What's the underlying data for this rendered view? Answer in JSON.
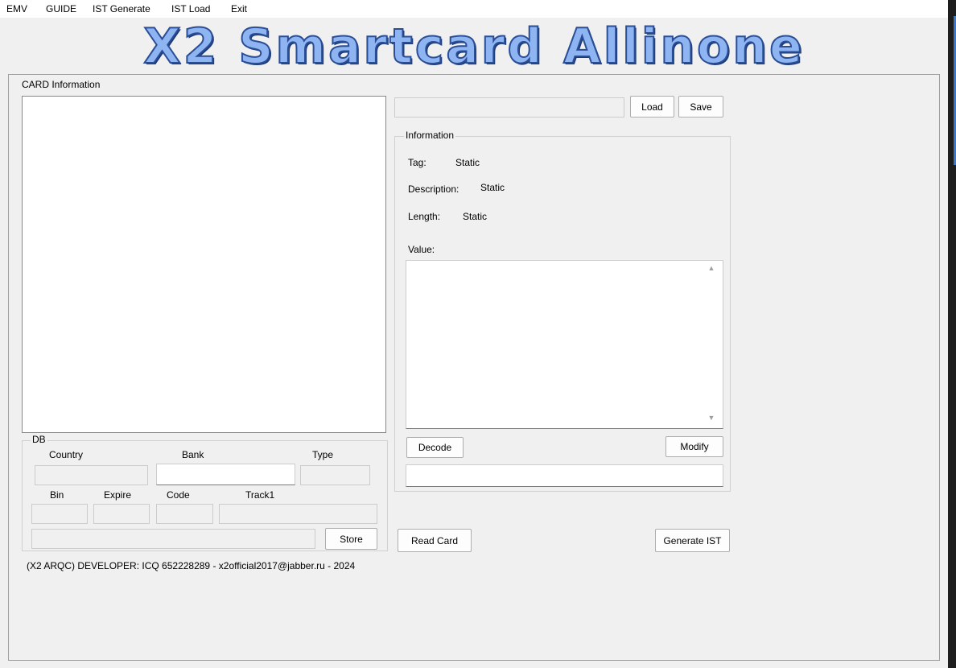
{
  "menu": {
    "emv": "EMV",
    "guide": "GUIDE",
    "ist_generate": "IST Generate",
    "ist_load": "IST Load",
    "exit": "Exit"
  },
  "logo": {
    "text": "X2 Smartcard Allinone",
    "color": "#8fb4f2",
    "outline": "#2a4e96"
  },
  "card_info": {
    "title": "CARD Information"
  },
  "file": {
    "path": "",
    "load_label": "Load",
    "save_label": "Save"
  },
  "information": {
    "title": "Information",
    "tag_label": "Tag:",
    "tag_value": "Static",
    "description_label": "Description:",
    "description_value": "Static",
    "length_label": "Length:",
    "length_value": "Static",
    "value_label": "Value:",
    "value_text": "",
    "decode_label": "Decode",
    "modify_label": "Modify",
    "decoded_text": ""
  },
  "db": {
    "title": "DB",
    "country_label": "Country",
    "bank_label": "Bank",
    "type_label": "Type",
    "bin_label": "Bin",
    "expire_label": "Expire",
    "code_label": "Code",
    "track1_label": "Track1",
    "store_label": "Store"
  },
  "actions": {
    "read_card_label": "Read Card",
    "generate_ist_label": "Generate IST"
  },
  "footer": {
    "text": "(X2 ARQC) DEVELOPER: ICQ 652228289 - x2official2017@jabber.ru - 2024"
  }
}
